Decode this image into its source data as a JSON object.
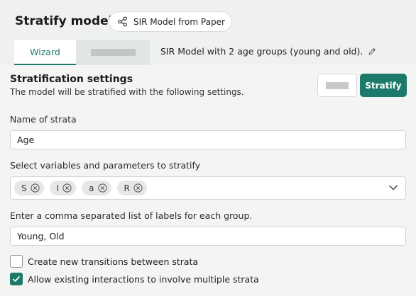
{
  "header": {
    "title": "Stratify model",
    "model_chip": "SIR Model from Paper",
    "tabs": [
      {
        "label": "Wizard"
      }
    ],
    "description": "SIR Model with 2 age groups (young and old)."
  },
  "settings": {
    "title": "Stratification settings",
    "subtitle": "The model will be stratified with the following settings.",
    "stratify_label": "Stratify"
  },
  "form": {
    "strata_name_label": "Name of strata",
    "strata_name_value": "Age",
    "variables_label": "Select variables and parameters to stratify",
    "variables": [
      "S",
      "I",
      "a",
      "R"
    ],
    "labels_label": "Enter a comma separated list of labels for each group.",
    "labels_value": "Young, Old",
    "checkboxes": [
      {
        "label": "Create new transitions between strata",
        "checked": false
      },
      {
        "label": "Allow existing interactions to involve multiple strata",
        "checked": true
      }
    ]
  },
  "colors": {
    "accent": "#1b7a6a",
    "header_bg": "#eef1ef"
  }
}
